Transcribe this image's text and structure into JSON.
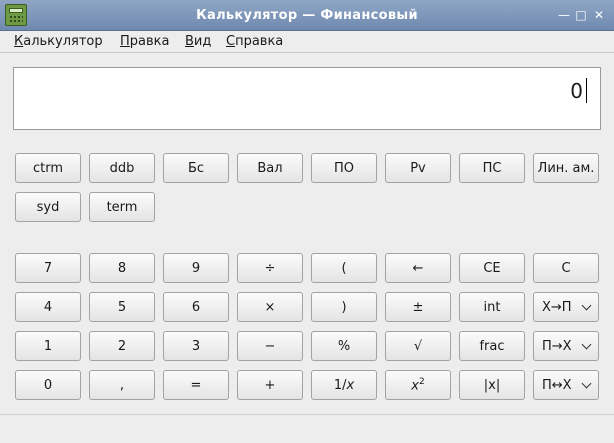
{
  "window": {
    "title": "Калькулятор — Финансовый",
    "minimize_glyph": "—",
    "maximize_glyph": "□",
    "close_glyph": "✕"
  },
  "menu": [
    {
      "accel": "К",
      "rest": "алькулятор"
    },
    {
      "accel": "П",
      "rest": "равка"
    },
    {
      "accel": "В",
      "rest": "ид"
    },
    {
      "accel": "С",
      "rest": "правка"
    }
  ],
  "display": {
    "value": "0"
  },
  "finance_buttons": [
    "ctrm",
    "ddb",
    "Бс",
    "Вал",
    "ПО",
    "Pv",
    "ПС",
    "Лин. ам.",
    "syd",
    "term"
  ],
  "keypad": [
    [
      "7",
      "8",
      "9",
      "÷",
      "(",
      "←",
      "CE",
      "C"
    ],
    [
      "4",
      "5",
      "6",
      "×",
      ")",
      "±",
      "int",
      "Х→П"
    ],
    [
      "1",
      "2",
      "3",
      "−",
      "%",
      "√",
      "frac",
      "П→Х"
    ],
    [
      "0",
      ",",
      "=",
      "+",
      "1/x",
      "x2",
      "|x|",
      "П↔Х"
    ]
  ],
  "icons": {
    "app": "calculator-icon",
    "dropdown": "chevron-down-icon"
  }
}
